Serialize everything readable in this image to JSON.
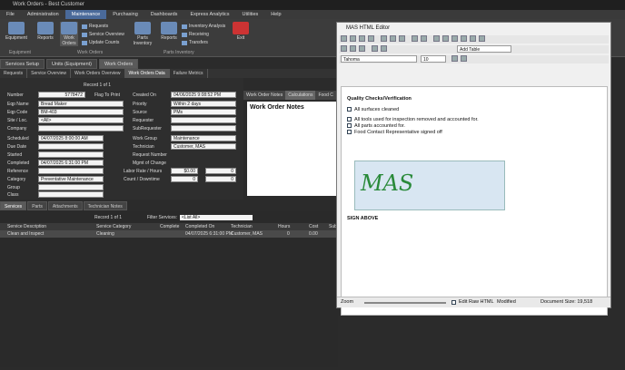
{
  "app": {
    "title": "Work Orders - Best Customer"
  },
  "menu": [
    "File",
    "Administration",
    "Maintenance",
    "Purchasing",
    "Dashboards",
    "Express Analytics",
    "Utilities",
    "Help"
  ],
  "ribbon": {
    "buttons": [
      "Equipment",
      "Reports",
      "Work Orders",
      "Parts Inventory",
      "Reports",
      "Exit"
    ],
    "small": [
      "Requests",
      "Service Overview",
      "Update Counts",
      "Inventory Analysis",
      "Receiving",
      "Transfers"
    ],
    "groups": [
      "Equipment",
      "Work Orders",
      "Parts Inventory"
    ]
  },
  "tabs": [
    "Services Setup",
    "Units (Equipment)",
    "Work Orders"
  ],
  "subtabs": [
    "Requests",
    "Service Overview",
    "Work Orders Overview",
    "Work Orders Data",
    "Failure Metrics"
  ],
  "record": {
    "text": "Record 1 of 1"
  },
  "form": {
    "number_label": "Number",
    "number": "5778472",
    "flag_label": "Flag To Print",
    "eqp_name_label": "Eqp Name",
    "eqp_name": "Bread Maker",
    "eqp_code_label": "Eqp Code",
    "eqp_code": "BM-403",
    "site_label": "Site / Loc.",
    "site": "<All>",
    "company_label": "Company",
    "scheduled_label": "Scheduled",
    "scheduled": "04/07/2025 8:00:00 AM",
    "due_label": "Due Date",
    "started_label": "Started",
    "completed_label": "Completed",
    "completed": "04/07/2025 6:31:00 PM",
    "reference_label": "Reference",
    "category_label": "Category",
    "category": "Preventative Maintenance",
    "group_label": "Group",
    "class_label": "Class",
    "created_label": "Created On",
    "created": "04/06/2025 9:08:52 PM",
    "priority_label": "Priority",
    "priority": "Within 2 days",
    "source_label": "Source",
    "source": "PMs",
    "requester_label": "Requester",
    "subrequester_label": "SubRequester",
    "workgroup_label": "Work Group",
    "workgroup": "Maintenance",
    "technician_label": "Technician",
    "technician": "Customer, MAS",
    "reqnum_label": "Request Number",
    "mgmt_label": "Mgmt of Change",
    "labor_label": "Labor Rate / Hours",
    "labor_rate": "$0.00",
    "labor_hours": "0",
    "count_label": "Count / Downtime",
    "count": "0",
    "downtime": "0"
  },
  "right_pane": {
    "tabs": [
      "Work Order Notes",
      "Calculations",
      "Food C"
    ],
    "title": "Work Order Notes"
  },
  "bottom_tabs": [
    "Services",
    "Parts",
    "Attachments",
    "Technician Notes"
  ],
  "grid": {
    "record": "Record 1 of 1",
    "filter_label": "Filter Services:",
    "filter_value": "<List All>",
    "headers": [
      "Service Description",
      "Service Category",
      "Complete",
      "Completed On",
      "Technician",
      "Hours",
      "Cost",
      "Sub"
    ],
    "row": [
      "Clean and Inspect",
      "Cleaning",
      "04/07/2025 6:31:00 PM",
      "Customer, MAS",
      "0",
      "0.00"
    ]
  },
  "editor": {
    "title": "MAS HTML Editor",
    "font": "Tahoma",
    "size": "10",
    "style": "Add Table",
    "heading": "Quality Checks/Verification",
    "checks": [
      "All surfaces cleaned",
      "All tools used for inspection removed and accounted for.",
      "All parts accounted for.",
      "Food Contact Representative signed off"
    ],
    "signature": "MAS",
    "sign_above": "SIGN ABOVE",
    "zoom_label": "Zoom",
    "edit_raw": "Edit Raw HTML",
    "modified": "Modified",
    "doc_size": "Document Size: 19,518"
  },
  "colors": {
    "accent": "#4a6a9a",
    "signature_ink": "#2a8a3a"
  }
}
